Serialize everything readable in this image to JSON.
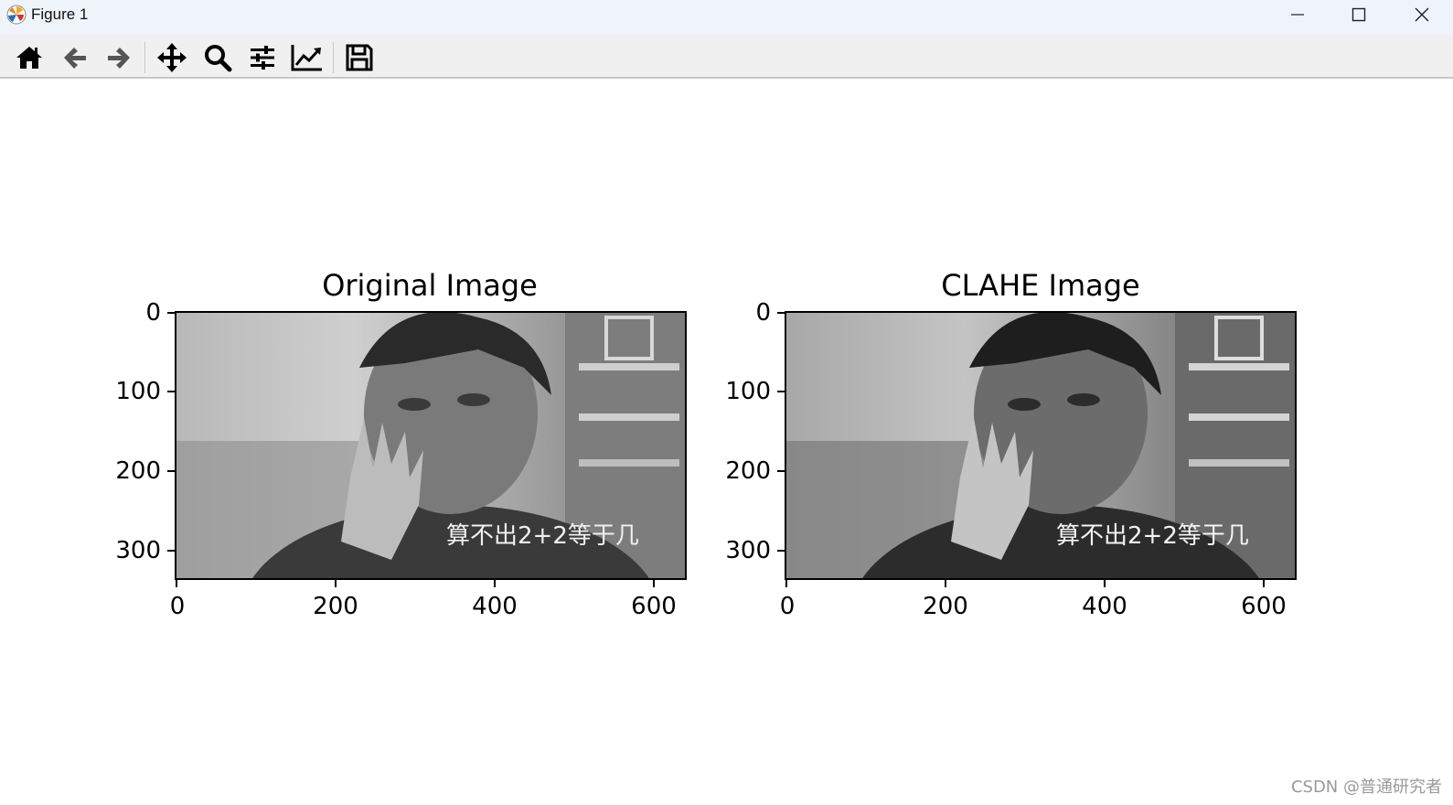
{
  "window": {
    "title": "Figure 1",
    "controls": [
      "minimize",
      "maximize",
      "close"
    ]
  },
  "toolbar": {
    "buttons": [
      {
        "name": "home",
        "icon": "home-icon"
      },
      {
        "name": "back",
        "icon": "arrow-left-icon"
      },
      {
        "name": "forward",
        "icon": "arrow-right-icon"
      },
      {
        "name": "pan",
        "icon": "move-icon"
      },
      {
        "name": "zoom",
        "icon": "magnifier-icon"
      },
      {
        "name": "configure-subplots",
        "icon": "sliders-icon"
      },
      {
        "name": "edit-axis",
        "icon": "line-chart-icon"
      },
      {
        "name": "save",
        "icon": "floppy-disk-icon"
      }
    ]
  },
  "figure": {
    "axes": [
      {
        "title": "Original Image",
        "xticks": [
          "0",
          "200",
          "400",
          "600"
        ],
        "yticks": [
          "0",
          "100",
          "200",
          "300"
        ],
        "image_caption": "算不出2+2等于几",
        "xlim": [
          0,
          640
        ],
        "ylim": [
          340,
          0
        ]
      },
      {
        "title": "CLAHE Image",
        "xticks": [
          "0",
          "200",
          "400",
          "600"
        ],
        "yticks": [
          "0",
          "100",
          "200",
          "300"
        ],
        "image_caption": "算不出2+2等于几",
        "xlim": [
          0,
          640
        ],
        "ylim": [
          340,
          0
        ]
      }
    ]
  },
  "watermark": "CSDN @普通研究者"
}
